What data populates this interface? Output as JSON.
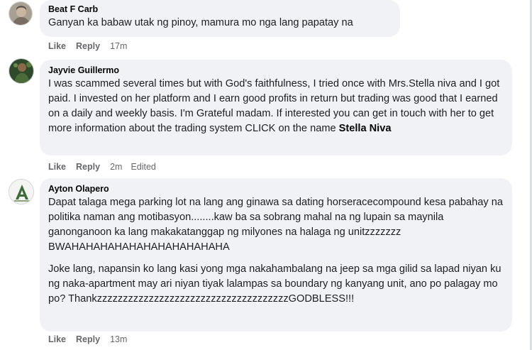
{
  "comments": [
    {
      "author": "Beat F Carb",
      "paragraphs": [
        "Ganyan ka babaw utak ng pinoy, mamura mo nga lang papatay na"
      ],
      "actions": {
        "like": "Like",
        "reply": "Reply",
        "time": "17m"
      }
    },
    {
      "author": "Jayvie Guillermo",
      "paragraphs": [
        "I was scammed several times but with God's faithfulness, I tried once with Mrs.Stella niva and I got paid. I invested on her platform and I earn good profits in return but trading was good that I earned on a daily and weekly basis. I'm Grateful madam. If interested you can get in touch with her to get more information about the trading system CLICK on the name"
      ],
      "mention": "Stella Niva",
      "actions": {
        "like": "Like",
        "reply": "Reply",
        "time": "2m",
        "edited": "Edited"
      }
    },
    {
      "author": "Ayton Olapero",
      "paragraphs": [
        "Dapat talaga mega parking lot na lang ang ginawa sa dating horseracecompound kesa pabahay na politika naman ang motibasyon........kaw ba sa sobrang mahal na ng lupain sa maynila ganonganoon ka lang makakatanggap ng milyones na halaga ng unitzzzzzzz BWAHAHAHAHAHAHAHAHAHAHAHA",
        "Joke lang, napansin ko lang kasi yong mga nakahambalang na jeep sa mga gilid sa lapad niyan kung naka-apartment may ari niyan tiyak lalampas sa boundary ng kanyang unit, ano po palagay mo po? ThankzzzzzzzzzzzzzzzzzzzzzzzzzzzzzzzzzzzzzGODBLESS!!!"
      ],
      "actions": {
        "like": "Like",
        "reply": "Reply",
        "time": "13m"
      }
    }
  ],
  "colors": {
    "bubble": "#f0f2f5",
    "author": "#050505",
    "text": "#1c1e21",
    "meta": "#65676b"
  }
}
